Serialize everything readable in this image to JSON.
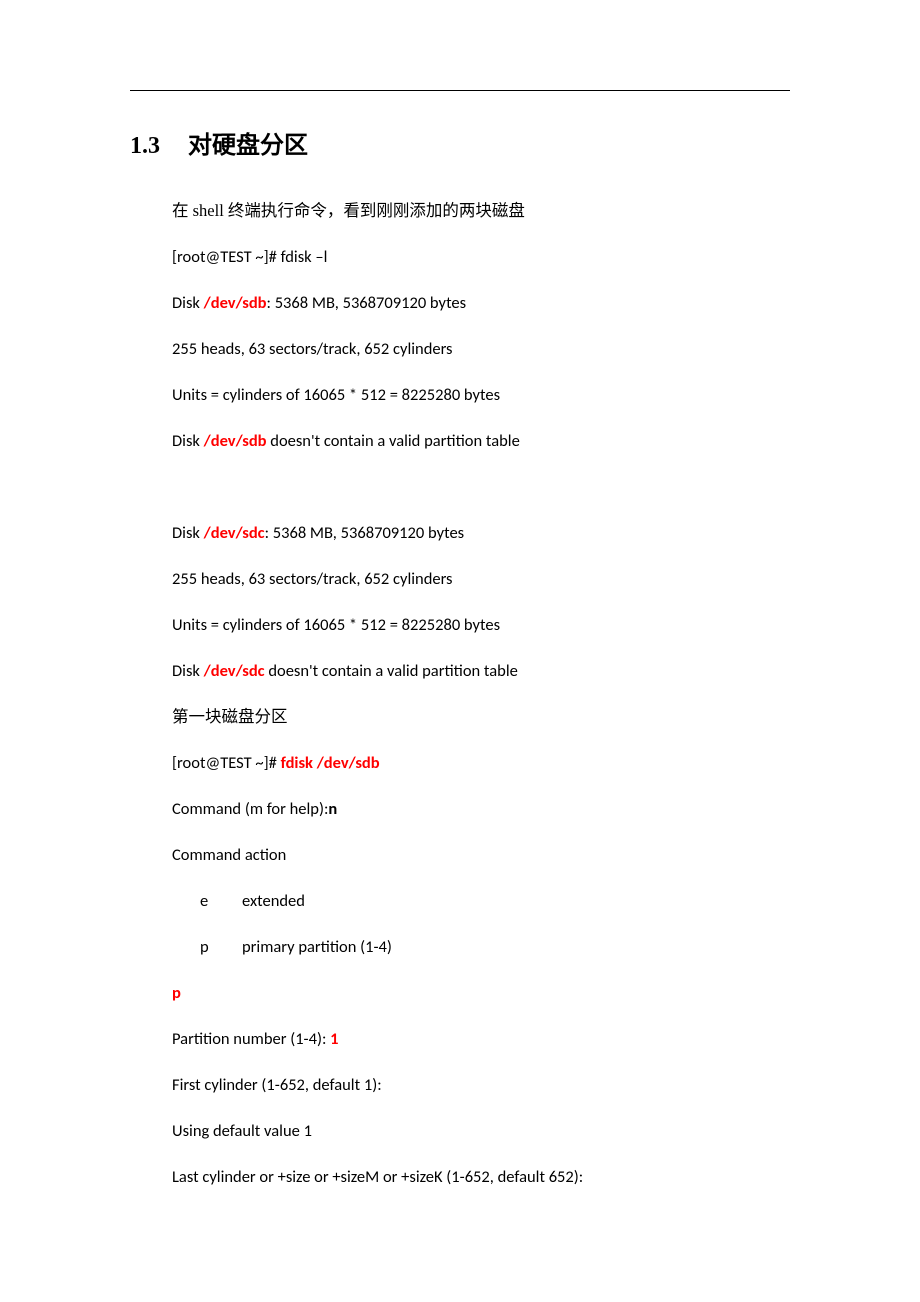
{
  "heading": {
    "number": "1.3",
    "title": "对硬盘分区"
  },
  "intro": {
    "pre": "在 shell 终端执行命令，看到刚刚添加的两块磁盘"
  },
  "cmd_list": "[root@TEST ~]# fdisk –l",
  "sdb": {
    "disk_prefix": "Disk ",
    "dev": "/dev/sdb",
    "size_suffix": ": 5368 MB, 5368709120 bytes",
    "heads": "255 heads, 63 sectors/track, 652 cylinders",
    "units": "Units = cylinders of 16065 * 512 = 8225280 bytes",
    "notable_prefix": "Disk ",
    "notable_suffix": " doesn't contain a valid partition table"
  },
  "sdc": {
    "disk_prefix": "Disk ",
    "dev": "/dev/sdc",
    "size_suffix": ": 5368 MB, 5368709120 bytes",
    "heads": "255 heads, 63 sectors/track, 652 cylinders",
    "units": "Units = cylinders of 16065 * 512 = 8225280 bytes",
    "notable_prefix": "Disk ",
    "notable_suffix": " doesn't contain a valid partition table"
  },
  "first_disk_label": "第一块磁盘分区",
  "fdisk_cmd": {
    "prompt": "[root@TEST ~]# ",
    "cmd": "fdisk /dev/sdb"
  },
  "command_m": {
    "prefix": "Command (m for help):",
    "input": "n"
  },
  "command_action": "Command action",
  "opt_e": {
    "letter": "e",
    "desc": "extended"
  },
  "opt_p": {
    "letter": "p",
    "desc": "primary partition (1-4)"
  },
  "choice_p": "p",
  "partnum": {
    "prefix": "Partition number (1-4): ",
    "input": "1"
  },
  "first_cyl": "First cylinder (1-652, default 1):",
  "using_default": "Using default value 1",
  "last_cyl": "Last cylinder or +size or +sizeM or +sizeK (1-652, default 652):"
}
